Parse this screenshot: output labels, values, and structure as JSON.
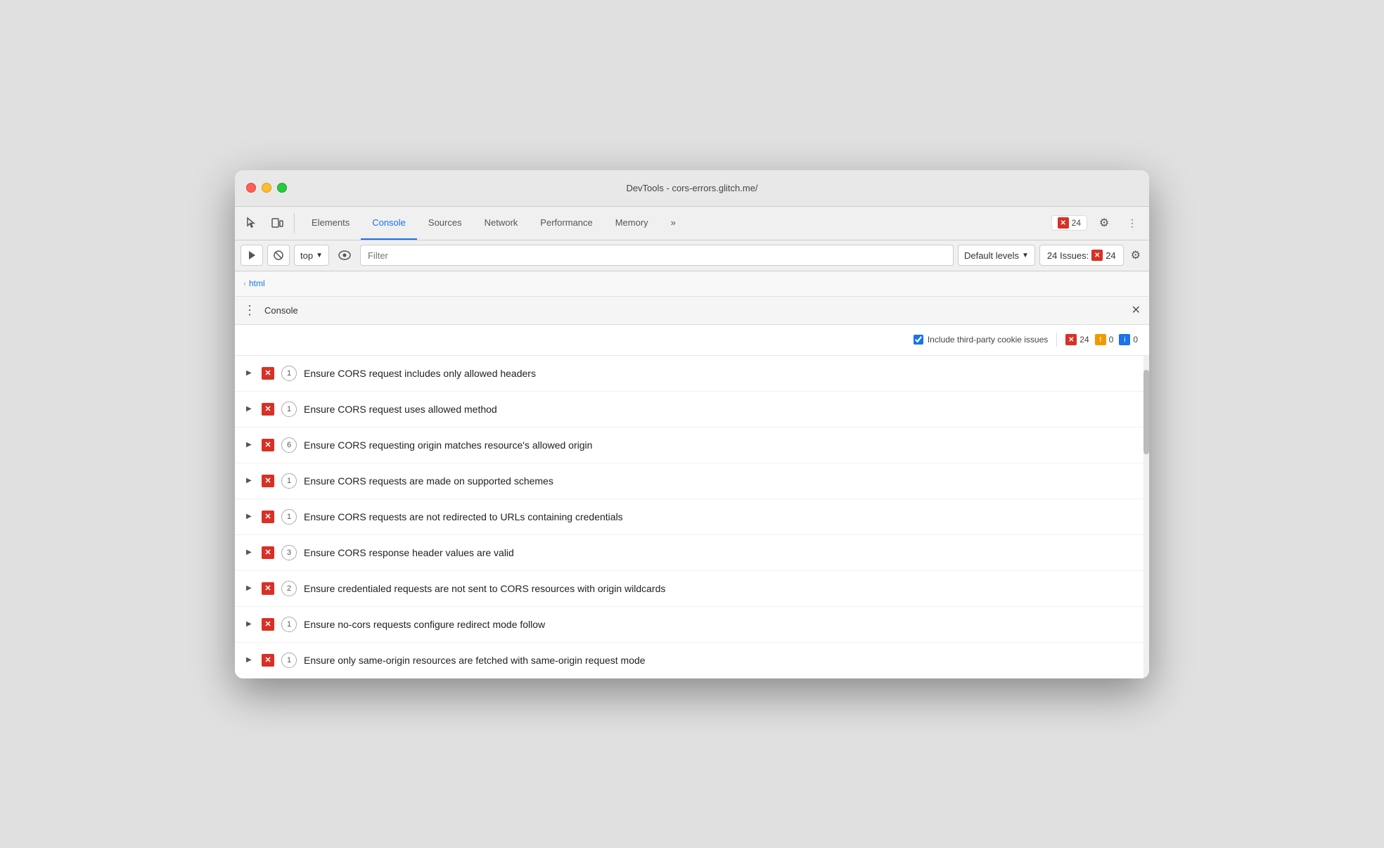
{
  "window": {
    "title": "DevTools - cors-errors.glitch.me/"
  },
  "header": {
    "tabs": [
      {
        "id": "elements",
        "label": "Elements",
        "active": false
      },
      {
        "id": "console",
        "label": "Console",
        "active": true
      },
      {
        "id": "sources",
        "label": "Sources",
        "active": false
      },
      {
        "id": "network",
        "label": "Network",
        "active": false
      },
      {
        "id": "performance",
        "label": "Performance",
        "active": false
      },
      {
        "id": "memory",
        "label": "Memory",
        "active": false
      }
    ],
    "more_label": "»",
    "issues_count": "24",
    "issues_icon": "✕"
  },
  "toolbar": {
    "top_label": "top",
    "filter_placeholder": "Filter",
    "levels_label": "Default levels",
    "issues_label": "24 Issues:",
    "issues_count": "24"
  },
  "breadcrumb": {
    "arrow": "‹",
    "html_label": "html"
  },
  "console_panel": {
    "title": "Console",
    "include_cookies_label": "Include third-party cookie issues",
    "error_count": "24",
    "warn_count": "0",
    "info_count": "0"
  },
  "issues": [
    {
      "id": 1,
      "count": 1,
      "text": "Ensure CORS request includes only allowed headers"
    },
    {
      "id": 2,
      "count": 1,
      "text": "Ensure CORS request uses allowed method"
    },
    {
      "id": 3,
      "count": 6,
      "text": "Ensure CORS requesting origin matches resource's allowed origin"
    },
    {
      "id": 4,
      "count": 1,
      "text": "Ensure CORS requests are made on supported schemes"
    },
    {
      "id": 5,
      "count": 1,
      "text": "Ensure CORS requests are not redirected to URLs containing credentials"
    },
    {
      "id": 6,
      "count": 3,
      "text": "Ensure CORS response header values are valid"
    },
    {
      "id": 7,
      "count": 2,
      "text": "Ensure credentialed requests are not sent to CORS resources with origin wildcards"
    },
    {
      "id": 8,
      "count": 1,
      "text": "Ensure no-cors requests configure redirect mode follow"
    },
    {
      "id": 9,
      "count": 1,
      "text": "Ensure only same-origin resources are fetched with same-origin request mode"
    }
  ]
}
